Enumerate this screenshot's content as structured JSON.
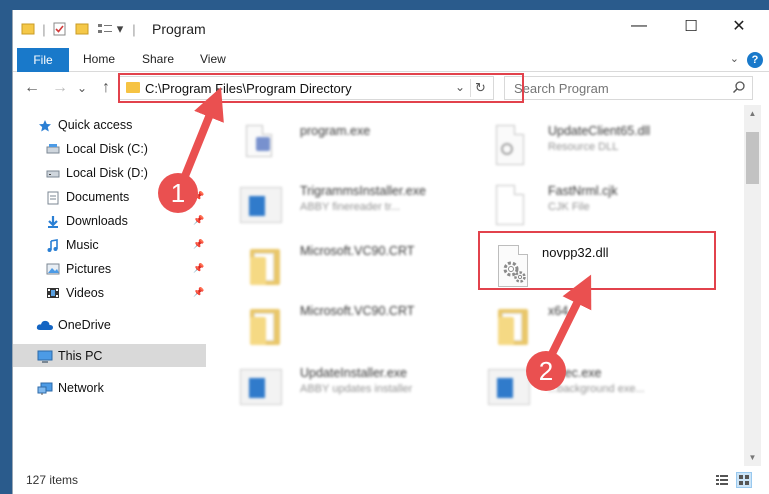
{
  "window": {
    "title": "Program",
    "controls": {
      "minimize": "—",
      "maximize": "☐",
      "close": "✕"
    }
  },
  "quick_access_toolbar": {
    "separator": "|",
    "dropdown": "▾"
  },
  "ribbon": {
    "tabs": [
      {
        "label": "File",
        "active": true
      },
      {
        "label": "Home"
      },
      {
        "label": "Share"
      },
      {
        "label": "View"
      }
    ],
    "collapse_glyph": "⌄",
    "help_glyph": "?"
  },
  "nav": {
    "back": "←",
    "forward": "→",
    "recent": "⌄",
    "up": "↑",
    "address": "C:\\Program Files\\Program Directory",
    "address_dropdown": "⌄",
    "refresh": "↻",
    "search_placeholder": "Search Program",
    "search_glyph": "⌕"
  },
  "sidebar": {
    "items": [
      {
        "label": "Quick access",
        "icon": "star-icon",
        "pinned": false
      },
      {
        "label": "Local Disk (C:)",
        "icon": "drive-icon",
        "pinned": false
      },
      {
        "label": "Local Disk (D:)",
        "icon": "drive-icon",
        "pinned": false
      },
      {
        "label": "Documents",
        "icon": "documents-icon",
        "pinned": true
      },
      {
        "label": "Downloads",
        "icon": "download-icon",
        "pinned": true
      },
      {
        "label": "Music",
        "icon": "music-icon",
        "pinned": true
      },
      {
        "label": "Pictures",
        "icon": "pictures-icon",
        "pinned": true
      },
      {
        "label": "Videos",
        "icon": "video-icon",
        "pinned": true
      },
      {
        "label": "OneDrive",
        "icon": "cloud-icon",
        "pinned": false
      },
      {
        "label": "This PC",
        "icon": "computer-icon",
        "pinned": false,
        "selected": true
      },
      {
        "label": "Network",
        "icon": "network-icon",
        "pinned": false
      }
    ],
    "pin_glyph": "📌"
  },
  "files": [
    {
      "name": "program.exe",
      "type": "",
      "icon": "program-exe-icon"
    },
    {
      "name": "UpdateClient65.dll",
      "type": "Resource DLL",
      "icon": "dll-icon"
    },
    {
      "name": "TrigrammsInstaller.exe",
      "type": "ABBY finereader tr...",
      "icon": "installer-icon"
    },
    {
      "name": "FastNrml.cjk",
      "type": "CJK File",
      "icon": "file-icon"
    },
    {
      "name": "Microsoft.VC90.CRT",
      "type": "",
      "icon": "folder-icon"
    },
    {
      "name": "novpp32.dll",
      "type": "",
      "icon": "dll-icon"
    },
    {
      "name": "Microsoft.VC90.CRT",
      "type": "",
      "icon": "folder-icon"
    },
    {
      "name": "x64",
      "type": "",
      "icon": "folder-icon"
    },
    {
      "name": "UpdateInstaller.exe",
      "type": "ABBY updates installer",
      "icon": "installer-icon"
    },
    {
      "name": "...sec.exe",
      "type": "...background exe...",
      "icon": "installer-icon"
    }
  ],
  "status": {
    "count": "127 items"
  },
  "annotations": {
    "badge1": "1",
    "badge2": "2"
  },
  "colors": {
    "accent": "#1979ca",
    "annotation": "#e2424c",
    "selection": "#d9d9d9"
  }
}
